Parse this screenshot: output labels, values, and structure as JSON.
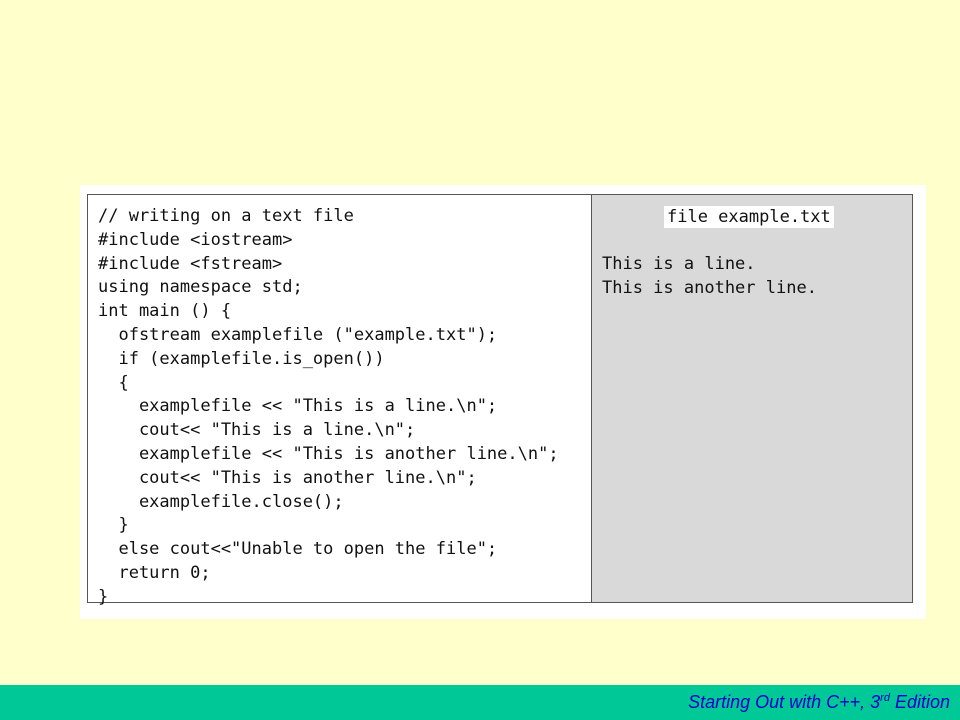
{
  "code": {
    "lines": [
      "// writing on a text file",
      "#include <iostream>",
      "#include <fstream>",
      "using namespace std;",
      "int main () {",
      "  ofstream examplefile (\"example.txt\");",
      "  if (examplefile.is_open())",
      "  {",
      "    examplefile << \"This is a line.\\n\";",
      "    cout<< \"This is a line.\\n\";",
      "    examplefile << \"This is another line.\\n\";",
      "    cout<< \"This is another line.\\n\";",
      "    examplefile.close();",
      "  }",
      "  else cout<<\"Unable to open the file\";",
      "  return 0;",
      "}"
    ]
  },
  "output": {
    "title": "file example.txt",
    "lines": [
      "This is a line.",
      "This is another line."
    ]
  },
  "footer": {
    "prefix": "Starting Out with C++, 3",
    "superscript": "rd",
    "suffix": " Edition"
  },
  "colors": {
    "background": "#ffffcc",
    "footer_bar": "#00c896",
    "footer_text": "#0000cc",
    "output_panel": "#d9d9d9"
  }
}
